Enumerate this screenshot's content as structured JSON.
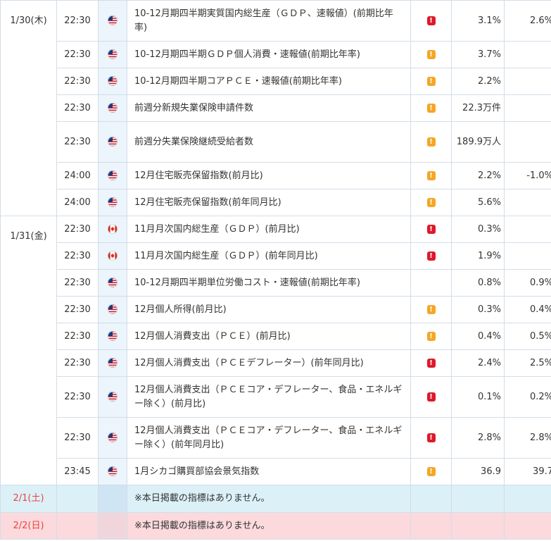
{
  "colors": {
    "high": "#dd1a2b",
    "mid": "#f5a623",
    "flag_bg": "#ecf4fc",
    "sat_bg": "#dcf0f8",
    "sun_bg": "#fbd9dc",
    "weekend_text": "#e8453c"
  },
  "icons": {
    "us": "us-flag-icon",
    "ca": "canada-flag-icon",
    "high": "high-importance-icon",
    "mid": "medium-importance-icon"
  },
  "days": [
    {
      "date": "1/30(木)",
      "rows": [
        {
          "time": "22:30",
          "country": "us",
          "name": "10-12月期四半期実質国内総生産（ＧＤＰ、速報値）(前期比年率)",
          "importance": "high",
          "previous": "3.1%",
          "forecast": "2.6%"
        },
        {
          "time": "22:30",
          "country": "us",
          "name": "10-12月期四半期ＧＤＰ個人消費・速報値(前期比年率)",
          "importance": "mid",
          "previous": "3.7%",
          "forecast": ""
        },
        {
          "time": "22:30",
          "country": "us",
          "name": "10-12月期四半期コアＰＣＥ・速報値(前期比年率)",
          "importance": "mid",
          "previous": "2.2%",
          "forecast": ""
        },
        {
          "time": "22:30",
          "country": "us",
          "name": "前週分新規失業保険申請件数",
          "importance": "mid",
          "previous": "22.3万件",
          "forecast": ""
        },
        {
          "time": "22:30",
          "country": "us",
          "name": "前週分失業保険継続受給者数",
          "importance": "mid",
          "previous": "189.9万人",
          "forecast": ""
        },
        {
          "time": "24:00",
          "country": "us",
          "name": "12月住宅販売保留指数(前月比)",
          "importance": "mid",
          "previous": "2.2%",
          "forecast": "-1.0%"
        },
        {
          "time": "24:00",
          "country": "us",
          "name": "12月住宅販売保留指数(前年同月比)",
          "importance": "mid",
          "previous": "5.6%",
          "forecast": ""
        }
      ]
    },
    {
      "date": "1/31(金)",
      "rows": [
        {
          "time": "22:30",
          "country": "ca",
          "name": "11月月次国内総生産（ＧＤＰ）(前月比)",
          "importance": "high",
          "previous": "0.3%",
          "forecast": ""
        },
        {
          "time": "22:30",
          "country": "ca",
          "name": "11月月次国内総生産（ＧＤＰ）(前年同月比)",
          "importance": "high",
          "previous": "1.9%",
          "forecast": ""
        },
        {
          "time": "22:30",
          "country": "us",
          "name": "10-12月期四半期単位労働コスト・速報値(前期比年率)",
          "importance": "",
          "previous": "0.8%",
          "forecast": "0.9%"
        },
        {
          "time": "22:30",
          "country": "us",
          "name": "12月個人所得(前月比)",
          "importance": "mid",
          "previous": "0.3%",
          "forecast": "0.4%"
        },
        {
          "time": "22:30",
          "country": "us",
          "name": "12月個人消費支出（ＰＣＥ）(前月比)",
          "importance": "mid",
          "previous": "0.4%",
          "forecast": "0.5%"
        },
        {
          "time": "22:30",
          "country": "us",
          "name": "12月個人消費支出（ＰＣＥデフレーター）(前年同月比)",
          "importance": "high",
          "previous": "2.4%",
          "forecast": "2.5%"
        },
        {
          "time": "22:30",
          "country": "us",
          "name": "12月個人消費支出（ＰＣＥコア・デフレーター、食品・エネルギー除く）(前月比)",
          "importance": "high",
          "previous": "0.1%",
          "forecast": "0.2%"
        },
        {
          "time": "22:30",
          "country": "us",
          "name": "12月個人消費支出（ＰＣＥコア・デフレーター、食品・エネルギー除く）(前年同月比)",
          "importance": "high",
          "previous": "2.8%",
          "forecast": "2.8%"
        },
        {
          "time": "23:45",
          "country": "us",
          "name": "1月シカゴ購買部協会景気指数",
          "importance": "mid",
          "previous": "36.9",
          "forecast": "39.7"
        }
      ]
    },
    {
      "date": "2/1(土)",
      "weekend": "sat",
      "message": "※本日掲載の指標はありません。"
    },
    {
      "date": "2/2(日)",
      "weekend": "sun",
      "message": "※本日掲載の指標はありません。"
    }
  ]
}
